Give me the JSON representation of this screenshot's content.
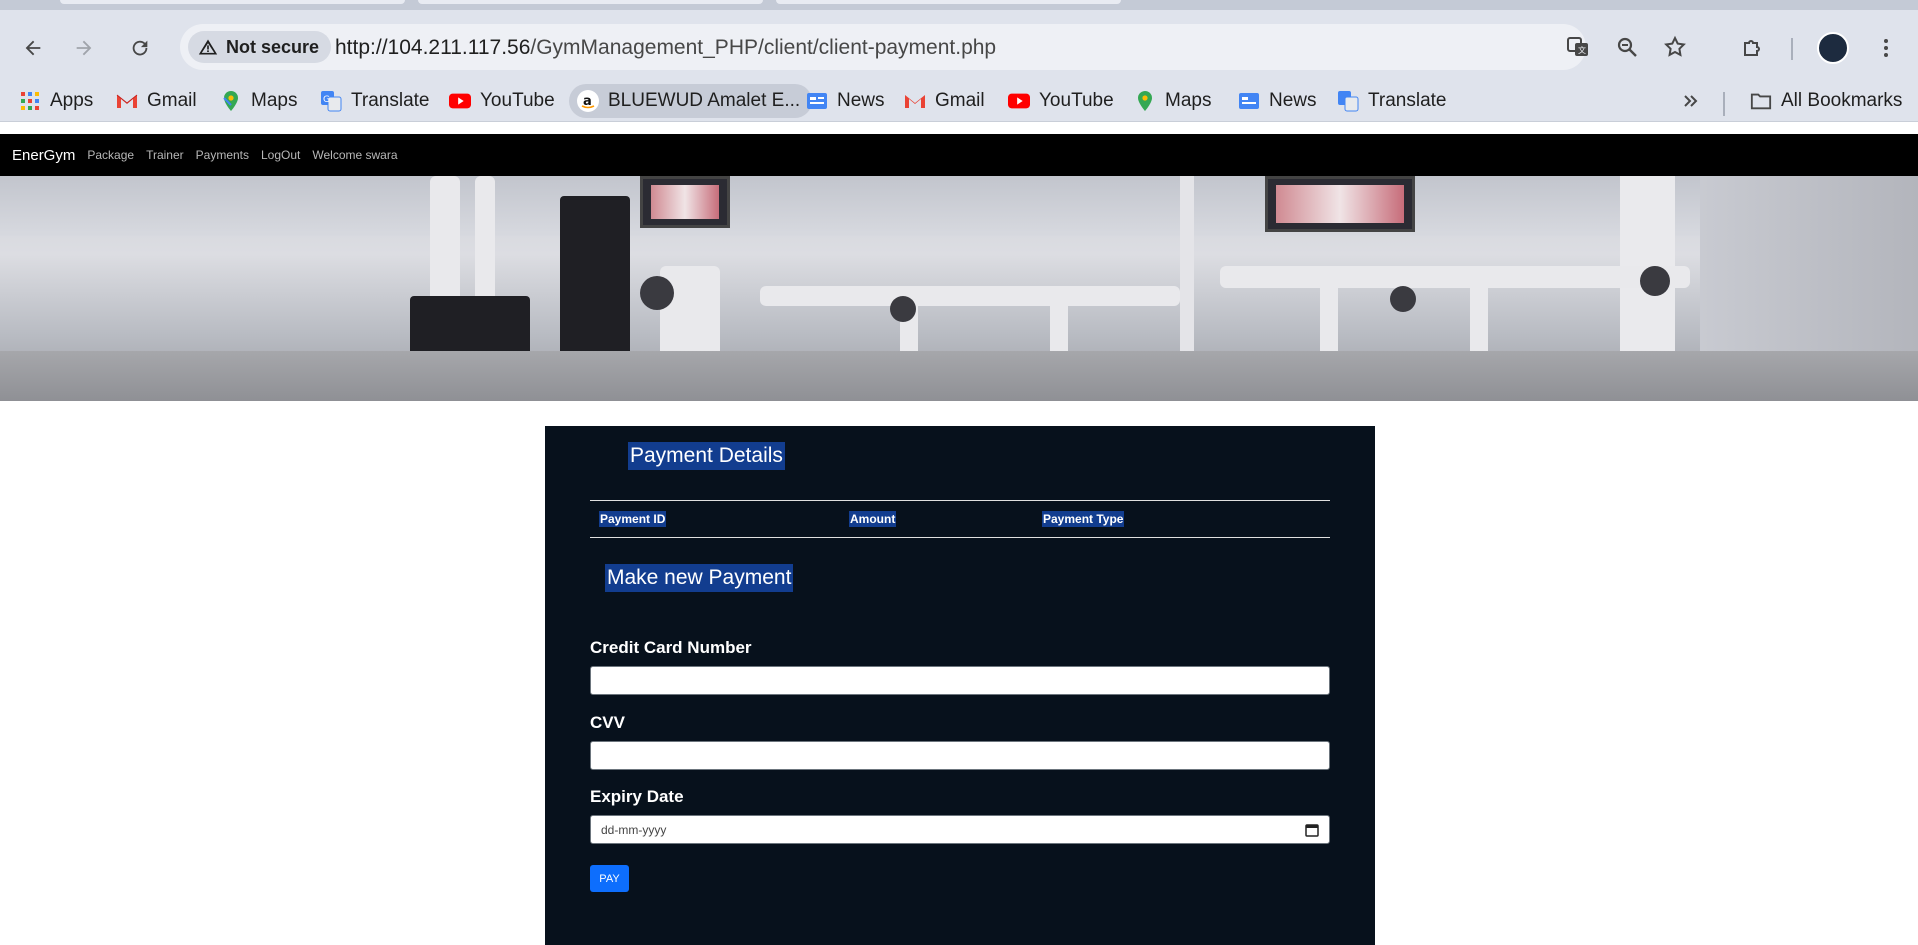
{
  "browser": {
    "security_chip": "Not secure",
    "url_host": "http://104.211.117.56",
    "url_path": "/GymManagement_PHP/client/client-payment.php"
  },
  "bookmarks": {
    "items": [
      {
        "label": "Apps",
        "icon": "apps-grid-icon"
      },
      {
        "label": "Gmail",
        "icon": "gmail-icon"
      },
      {
        "label": "Maps",
        "icon": "maps-icon"
      },
      {
        "label": "Translate",
        "icon": "translate-icon"
      },
      {
        "label": "YouTube",
        "icon": "youtube-icon"
      },
      {
        "label": "BLUEWUD Amalet E...",
        "icon": "amazon-icon"
      },
      {
        "label": "News",
        "icon": "news-icon"
      },
      {
        "label": "Gmail",
        "icon": "gmail-icon"
      },
      {
        "label": "YouTube",
        "icon": "youtube-icon"
      },
      {
        "label": "Maps",
        "icon": "maps-icon"
      },
      {
        "label": "News",
        "icon": "news-icon"
      },
      {
        "label": "Translate",
        "icon": "translate-icon"
      }
    ],
    "all_bookmarks": "All Bookmarks"
  },
  "site_nav": {
    "brand": "EnerGym",
    "links": [
      "Package",
      "Trainer",
      "Payments",
      "LogOut",
      "Welcome swara"
    ]
  },
  "panel": {
    "title": "Payment Details",
    "table_headers": [
      "Payment ID",
      "Amount",
      "Payment Type"
    ],
    "new_payment_title": "Make new Payment",
    "card_label": "Credit Card Number",
    "card_value": "",
    "cvv_label": "CVV",
    "cvv_value": "",
    "expiry_label": "Expiry Date",
    "expiry_placeholder": "dd-mm-yyyy",
    "pay_button": "PAY"
  },
  "colors": {
    "panel_bg": "#07111c",
    "highlight": "#123d8f",
    "pay_button": "#0d6efd",
    "navbar": "#000000"
  }
}
